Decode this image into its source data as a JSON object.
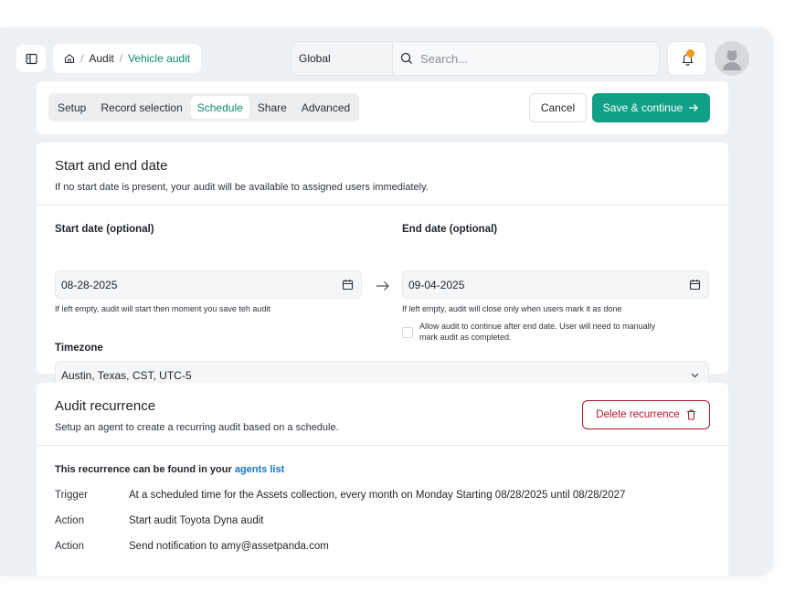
{
  "breadcrumb": {
    "items": [
      "Audit",
      "Vehicle audit"
    ],
    "separator": "/"
  },
  "header": {
    "scope": "Global",
    "search_placeholder": "Search..."
  },
  "tabs": [
    {
      "label": "Setup"
    },
    {
      "label": "Record selection"
    },
    {
      "label": "Schedule",
      "active": true
    },
    {
      "label": "Share"
    },
    {
      "label": "Advanced"
    }
  ],
  "actions": {
    "cancel": "Cancel",
    "save": "Save & continue"
  },
  "dates": {
    "title": "Start and end date",
    "subtitle": "If no start date is present, your audit will be available to assigned users immediately.",
    "start_label": "Start date (optional)",
    "start_value": "08-28-2025",
    "start_hint": "If left empty, audit will start then moment you save teh audit",
    "end_label": "End date (optional)",
    "end_value": "09-04-2025",
    "end_hint": "If left empty, audit will close only when users mark it as done",
    "continue_label": "Allow audit to continue after end date. User will need to manually mark audit as completed.",
    "continue_checked": false,
    "timezone_label": "Timezone",
    "timezone_value": "Austin, Texas, CST, UTC-5"
  },
  "recurrence": {
    "title": "Audit recurrence",
    "subtitle": "Setup an agent to create a recurring audit based on a schedule.",
    "delete_label": "Delete recurrence",
    "note_prefix": "This recurrence can be found in your",
    "note_link": "agents list",
    "rows": [
      {
        "key": "Trigger",
        "value": "At a scheduled time for the Assets collection, every month on Monday Starting 08/28/2025 until 08/28/2027"
      },
      {
        "key": "Action",
        "value": "Start audit Toyota Dyna audit"
      },
      {
        "key": "Action",
        "value": "Send notification to amy@assetpanda.com"
      }
    ]
  },
  "colors": {
    "accent": "#10a085",
    "danger": "#b0182d",
    "link": "#1475c9",
    "notification": "#f29a1a"
  },
  "icons": [
    "sidebar-toggle-icon",
    "home-icon",
    "search-icon",
    "bell-icon",
    "user-icon",
    "calendar-icon",
    "arrow-right-icon",
    "chevron-down-icon",
    "trash-icon"
  ]
}
